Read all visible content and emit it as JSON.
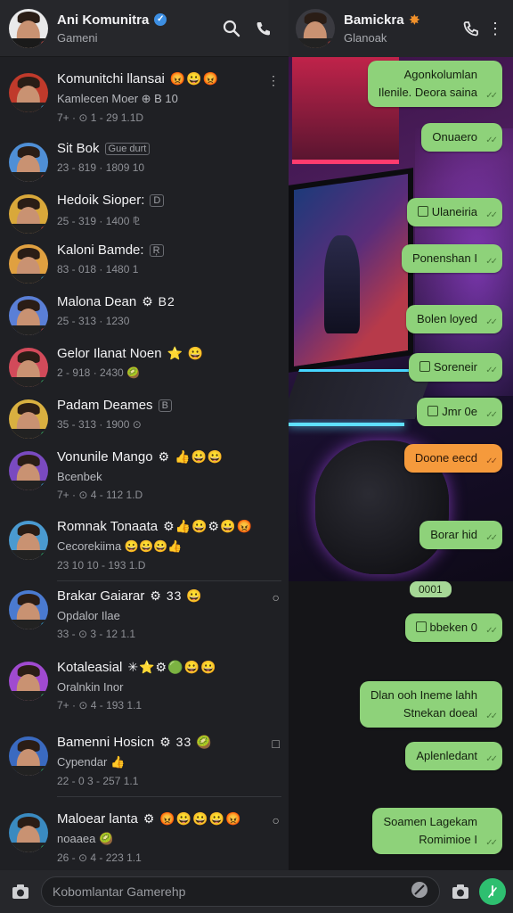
{
  "left_header": {
    "title": "Ani Komunitra",
    "subtitle": "Gameni"
  },
  "chats": [
    {
      "name": "Komunitchi llansai",
      "emoji": "😡😀😡",
      "tag": "",
      "preview": "Kamlecen Moer  ⊕ B 10",
      "time": "7+ · ⊙ 1 - 29  1.1D",
      "avatar_bg": "#c03a2b",
      "badge": "#3ab0e0",
      "menu": "⋮"
    },
    {
      "name": "Sit Bok",
      "emoji": "",
      "tag": "Gue durt",
      "preview": "",
      "time": "23 - 819 · 1809  10",
      "avatar_bg": "#4f8fd6",
      "badge": "#d9453b",
      "menu": ""
    },
    {
      "name": "Hedoik Sioper:",
      "emoji": "",
      "tag": "D",
      "preview": "",
      "time": "25 - 319 · 1400  ⅊",
      "avatar_bg": "#d9a83a",
      "badge": "#d9453b",
      "menu": ""
    },
    {
      "name": "Kaloni Bamde:",
      "emoji": "",
      "tag": "Ŗ",
      "preview": "",
      "time": "83 - 018 · 1480  1",
      "avatar_bg": "#e0a040",
      "badge": "#3ab0e0",
      "menu": ""
    },
    {
      "name": "Malona Dean",
      "emoji": "⚙ B2",
      "tag": "",
      "preview": "",
      "time": "25 - 313 · 1230",
      "avatar_bg": "#5a7fd6",
      "badge": "#d9453b",
      "menu": ""
    },
    {
      "name": "Gelor Ilanat Noen",
      "emoji": "⭐  😀",
      "tag": "",
      "preview": "",
      "time": "2 - 918 · 2430  🥝",
      "avatar_bg": "#d24a5a",
      "badge": "#2ecc71",
      "menu": ""
    },
    {
      "name": "Padam Deames",
      "emoji": "",
      "tag": "B",
      "preview": "",
      "time": "35 - 313 · 1900  ⊙",
      "avatar_bg": "#d9b040",
      "badge": "#2ecc71",
      "menu": ""
    },
    {
      "name": "Vonunile Mango",
      "emoji": "⚙ 👍😀😀",
      "tag": "",
      "preview": "Bcenbek",
      "time": "7+ · ⊙ 4 - 112  1.D",
      "avatar_bg": "#7a4ac0",
      "badge": "#3ab0e0",
      "menu": ""
    },
    {
      "name": "Romnak Tonaata",
      "emoji": "⚙👍😀⚙😀😡",
      "tag": "",
      "preview": "Cecorekiima  😀😀😀👍",
      "time": "23 10 10 - 193  1.D",
      "avatar_bg": "#4a9ad0",
      "badge": "#2ecc71",
      "menu": ""
    },
    {
      "name": "Brakar Gaiarar",
      "emoji": "⚙ 33  😀",
      "tag": "",
      "preview": "Opdalor  Ilae",
      "time": "33 - ⊙ 3 - 12  1.1",
      "avatar_bg": "#4a7ad0",
      "badge": "#3ab0e0",
      "menu": "○"
    },
    {
      "name": "Kotaleasial",
      "emoji": "✳⭐⚙🟢😀😀",
      "tag": "",
      "preview": "Oralnkin  Inor",
      "time": "7+ · ⊙ 4 - 193  1.1",
      "avatar_bg": "#a04ad0",
      "badge": "#2ecc71",
      "menu": ""
    },
    {
      "name": "Bamenni Hosicn",
      "emoji": "⚙ 33  🥝",
      "tag": "",
      "preview": "Cypendar  👍",
      "time": "22 - 0 3 - 257  1.1",
      "avatar_bg": "#3a6ac0",
      "badge": "#2ecc71",
      "menu": "□"
    },
    {
      "name": "Maloear lanta",
      "emoji": "⚙ 😡😀😀😀😡",
      "tag": "",
      "preview": "noaaea  🥝",
      "time": "26 - ⊙ 4 - 223  1.1",
      "avatar_bg": "#3a8ac0",
      "badge": "#2ecc71",
      "menu": "○"
    }
  ],
  "right_header": {
    "title": "Bamickra",
    "subtitle": "Glanoak"
  },
  "messages": [
    {
      "lines": [
        "Agonkolumlan",
        "Ilenile. Deora saina"
      ],
      "style": "green",
      "icon": false
    },
    {
      "lines": [
        "Onuaero"
      ],
      "style": "green",
      "icon": false
    },
    {
      "lines": [
        "Ulaneiria"
      ],
      "style": "green",
      "icon": true
    },
    {
      "lines": [
        "Ponenshan I"
      ],
      "style": "green",
      "icon": false
    },
    {
      "lines": [
        "Bolen loyed"
      ],
      "style": "green",
      "icon": false
    },
    {
      "lines": [
        "Soreneir"
      ],
      "style": "green",
      "icon": true
    },
    {
      "lines": [
        "Jmr 0e"
      ],
      "style": "green",
      "icon": true
    },
    {
      "lines": [
        "Doone eecd"
      ],
      "style": "orange",
      "icon": false
    },
    {
      "lines": [
        "Borar hid"
      ],
      "style": "green",
      "icon": false
    },
    {
      "lines": [
        "bbeken 0"
      ],
      "style": "green",
      "icon": true
    },
    {
      "lines": [
        "Dlan ooh Ineme lahh",
        "Stnekan doeal"
      ],
      "style": "green",
      "icon": false
    },
    {
      "lines": [
        "Aplenledant"
      ],
      "style": "green",
      "icon": false
    },
    {
      "lines": [
        "Soamen Lagekam",
        "Romimioe I"
      ],
      "style": "green",
      "icon": false
    }
  ],
  "date_chip": "0001",
  "composer": {
    "placeholder": "Kobomlantar Gamerehp"
  },
  "colors": {
    "bubble": "#8ed27a",
    "bubble_orange": "#f59a3c",
    "send": "#2ebf70",
    "verified": "#3d8fe3"
  }
}
